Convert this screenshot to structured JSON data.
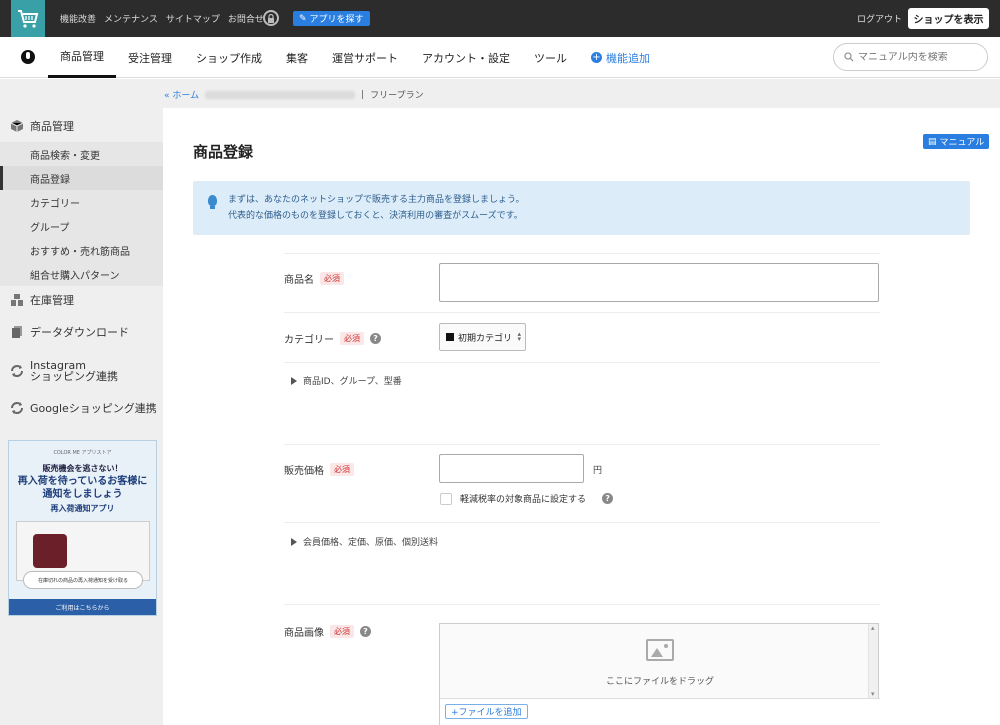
{
  "topbar": {
    "links": [
      "機能改善",
      "メンテナンス",
      "サイトマップ",
      "お問合せ"
    ],
    "app_button": "アプリを探す",
    "logout": "ログアウト",
    "show_shop": "ショップを表示"
  },
  "nav": {
    "items": [
      "商品管理",
      "受注管理",
      "ショップ作成",
      "集客",
      "運営サポート",
      "アカウント・設定",
      "ツール"
    ],
    "add_feature": "機能追加",
    "search_placeholder": "マニュアル内を検索"
  },
  "breadcrumb": {
    "home": "« ホーム",
    "plan": "フリープラン"
  },
  "sidebar": {
    "product_mgmt": "商品管理",
    "sub_items": [
      "商品検索・変更",
      "商品登録",
      "カテゴリー",
      "グループ",
      "おすすめ・売れ筋商品",
      "組合せ購入パターン"
    ],
    "stock_mgmt": "在庫管理",
    "data_download": "データダウンロード",
    "instagram_line1": "Instagram",
    "instagram_line2": "ショッピング連携",
    "google_shopping": "Googleショッピング連携"
  },
  "banner": {
    "brand": "COLOR ME アプリストア",
    "line1": "販売機会を逃さない！",
    "line2a": "再入荷を待っているお客様に",
    "line2b": "通知をしましょう",
    "app_name": "再入荷通知アプリ",
    "pill": "在庫切れの商品の再入荷通知を受け取る",
    "footer": "ご利用はこちらから"
  },
  "main": {
    "title": "商品登録",
    "manual": "マニュアル",
    "info_line1": "まずは、あなたのネットショップで販売する主力商品を登録しましょう。",
    "info_line2": "代表的な価格のものを登録しておくと、決済利用の審査がスムーズです。",
    "required": "必須",
    "product_name_label": "商品名",
    "category_label": "カテゴリー",
    "category_value": "初期カテゴリ",
    "toggle_ids": "商品ID、グループ、型番",
    "price_label": "販売価格",
    "yen": "円",
    "reduced_tax": "軽減税率の対象商品に設定する",
    "toggle_prices": "会員価格、定価、原価、個別送料",
    "image_label": "商品画像",
    "drop_text": "ここにファイルをドラッグ",
    "add_file": "+ファイルを追加"
  }
}
